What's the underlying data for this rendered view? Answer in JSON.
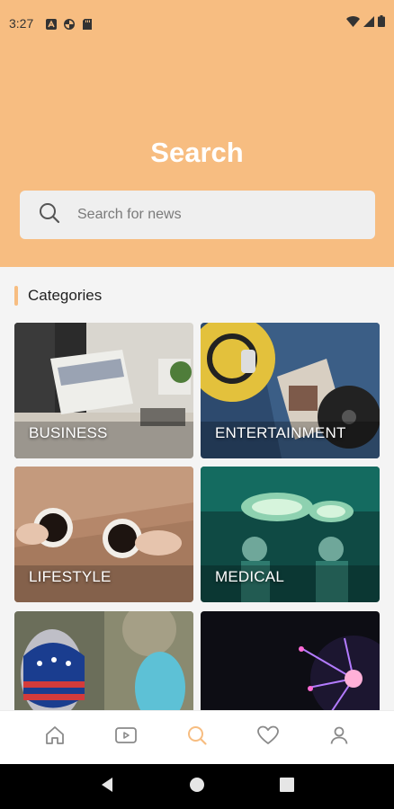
{
  "status_bar": {
    "time": "3:27",
    "notification_icons": [
      "a-icon",
      "pinwheel-icon",
      "sd-card-icon"
    ],
    "system_icons": [
      "wifi-icon",
      "signal-icon",
      "battery-icon"
    ]
  },
  "header": {
    "title": "Search",
    "background_color": "#f7bd81"
  },
  "search": {
    "placeholder": "Search for news",
    "value": ""
  },
  "categories": {
    "title": "Categories",
    "items": [
      {
        "label": "BUSINESS"
      },
      {
        "label": "ENTERTAINMENT"
      },
      {
        "label": "LIFESTYLE"
      },
      {
        "label": "MEDICAL"
      },
      {
        "label": ""
      },
      {
        "label": ""
      }
    ]
  },
  "bottom_nav": {
    "items": [
      {
        "icon": "home-icon",
        "active": false
      },
      {
        "icon": "video-icon",
        "active": false
      },
      {
        "icon": "search-icon",
        "active": true
      },
      {
        "icon": "heart-icon",
        "active": false
      },
      {
        "icon": "person-icon",
        "active": false
      }
    ],
    "active_color": "#f7bd81",
    "inactive_color": "#8a8a8a"
  },
  "system_nav": {
    "items": [
      "back-icon",
      "home-circle-icon",
      "recents-icon"
    ]
  }
}
